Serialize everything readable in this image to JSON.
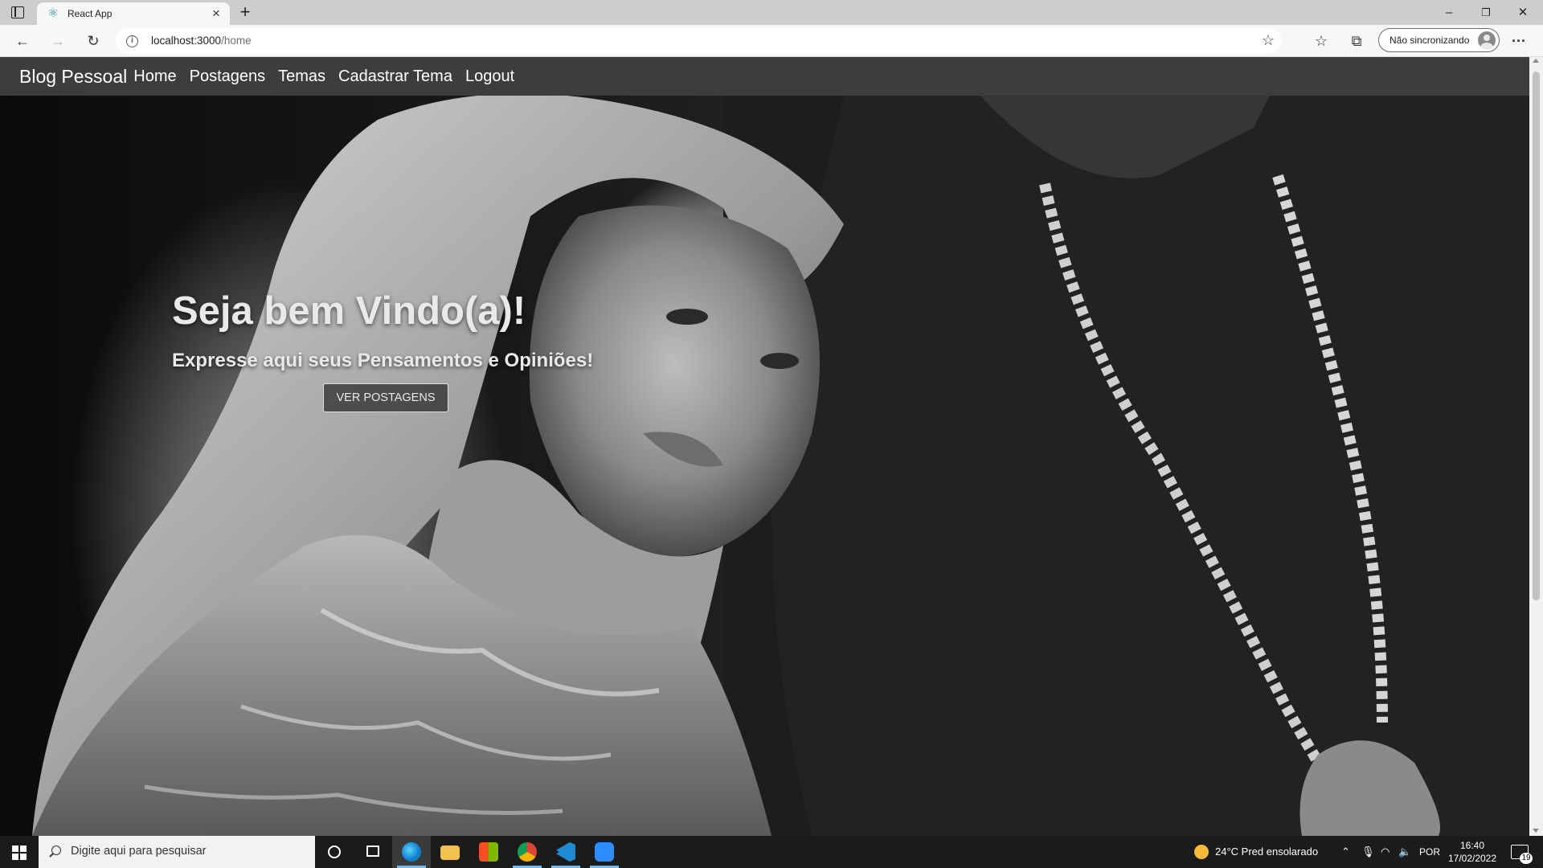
{
  "browser": {
    "tab_title": "React App",
    "new_tab": "+",
    "url_host": "localhost:3000",
    "url_path": "/home",
    "profile_label": "Não sincronizando",
    "window_controls": {
      "minimize": "–",
      "restore": "❐",
      "close": "✕"
    },
    "icons": {
      "back": "←",
      "forward": "→",
      "refresh": "↻",
      "favorites": "☆",
      "collections": "⧉",
      "more": "···"
    }
  },
  "navbar": {
    "brand": "Blog Pessoal",
    "links": [
      "Home",
      "Postagens",
      "Temas",
      "Cadastrar Tema",
      "Logout"
    ]
  },
  "hero": {
    "title": "Seja bem Vindo(a)!",
    "subtitle": "Expresse aqui seus Pensamentos e Opiniões!",
    "button_label": "VER POSTAGENS"
  },
  "taskbar": {
    "search_placeholder": "Digite aqui para pesquisar",
    "weather": "24°C  Pred ensolarado",
    "language": "POR",
    "time": "16:40",
    "date": "17/02/2022",
    "notifications": "19"
  }
}
